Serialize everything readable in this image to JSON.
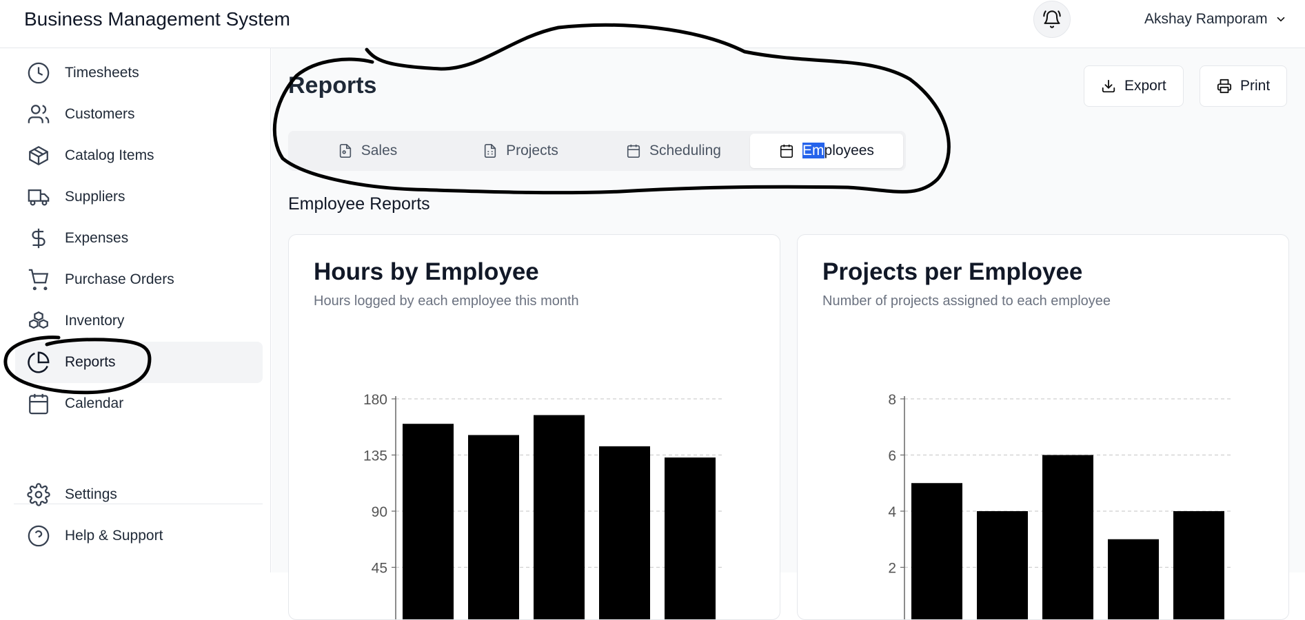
{
  "header": {
    "app_title": "Business Management System",
    "user_name": "Akshay Ramporam"
  },
  "sidebar": {
    "items": [
      {
        "label": "Timesheets",
        "icon": "clock-icon"
      },
      {
        "label": "Customers",
        "icon": "users-icon"
      },
      {
        "label": "Catalog Items",
        "icon": "box-icon"
      },
      {
        "label": "Suppliers",
        "icon": "truck-icon"
      },
      {
        "label": "Expenses",
        "icon": "dollar-icon"
      },
      {
        "label": "Purchase Orders",
        "icon": "cart-icon"
      },
      {
        "label": "Inventory",
        "icon": "boxes-icon"
      },
      {
        "label": "Reports",
        "icon": "pie-chart-icon",
        "active": true
      },
      {
        "label": "Calendar",
        "icon": "calendar-icon"
      }
    ],
    "bottom_items": [
      {
        "label": "Settings",
        "icon": "gear-icon"
      },
      {
        "label": "Help & Support",
        "icon": "help-icon"
      }
    ]
  },
  "main": {
    "page_title": "Reports",
    "export_label": "Export",
    "print_label": "Print",
    "tabs": [
      {
        "label": "Sales",
        "icon": "file-icon"
      },
      {
        "label": "Projects",
        "icon": "document-icon"
      },
      {
        "label": "Scheduling",
        "icon": "calendar-icon"
      },
      {
        "label_highlight": "Em",
        "label_rest": "ployees",
        "icon": "calendar-icon",
        "active": true
      }
    ],
    "section_title": "Employee Reports"
  },
  "chart_data": [
    {
      "type": "bar",
      "title": "Hours by Employee",
      "subtitle": "Hours logged by each employee this month",
      "yticks": [
        45,
        90,
        135,
        180
      ],
      "ylim": [
        0,
        180
      ],
      "values": [
        160,
        151,
        167,
        142,
        133
      ],
      "grid": true,
      "color": "#000000"
    },
    {
      "type": "bar",
      "title": "Projects per Employee",
      "subtitle": "Number of projects assigned to each employee",
      "yticks": [
        2,
        4,
        6,
        8
      ],
      "ylim": [
        0,
        8
      ],
      "values": [
        5,
        4,
        6,
        3,
        4
      ],
      "grid": true,
      "color": "#000000"
    }
  ]
}
